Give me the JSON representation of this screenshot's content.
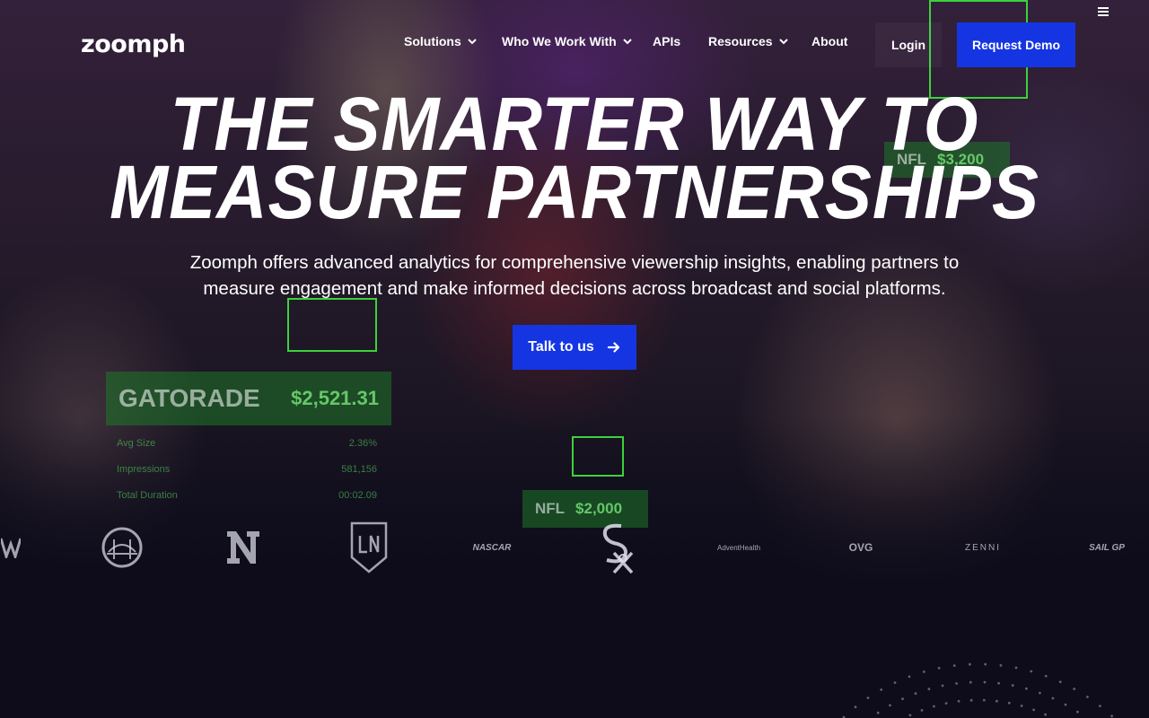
{
  "brand": {
    "logo_text": "zoomph"
  },
  "nav": {
    "items": [
      {
        "label": "Solutions",
        "has_dropdown": true
      },
      {
        "label": "Who We Work With",
        "has_dropdown": true
      },
      {
        "label": "APIs",
        "has_dropdown": false
      },
      {
        "label": "Resources",
        "has_dropdown": true
      },
      {
        "label": "About",
        "has_dropdown": false
      }
    ],
    "login_label": "Login",
    "demo_label": "Request Demo",
    "menu_icon": "hamburger-icon"
  },
  "hero": {
    "headline_line1": "THE SMARTER WAY TO",
    "headline_line2": "MEASURE PARTNERSHIPS",
    "subtitle": "Zoomph offers advanced analytics for comprehensive viewership insights, enabling partners to measure engagement and make informed decisions across broadcast and social platforms.",
    "cta_label": "Talk to us",
    "cta_icon": "arrow-right-icon"
  },
  "background_tags": {
    "gatorade": {
      "name": "GATORADE",
      "amount": "$2,521.31"
    },
    "nfl_top": {
      "name": "NFL",
      "amount": "$3,200"
    },
    "nfl_bottom": {
      "name": "NFL",
      "amount": "$2,000"
    },
    "stats": [
      {
        "label": "Avg Size",
        "value": "2.36%"
      },
      {
        "label": "Impressions",
        "value": "581,156"
      },
      {
        "label": "Total Duration",
        "value": "00:02.09"
      }
    ]
  },
  "partner_logos": [
    "partial-logo",
    "golden-state-warriors-logo",
    "nebraska-logo",
    "lafc-logo",
    "nascar-logo",
    "white-sox-logo",
    "adventhealth-logo",
    "ovg-logo",
    "zenni-logo",
    "sailgp-logo"
  ],
  "partner_logo_text": {
    "nascar": "NASCAR",
    "adventhealth": "AdventHealth",
    "ovg": "OVG",
    "zenni": "ZENNI",
    "sailgp": "SAIL GP"
  },
  "colors": {
    "accent": "#1535e3",
    "background": "#0e0c1b",
    "tag_green": "#3bd23b"
  }
}
